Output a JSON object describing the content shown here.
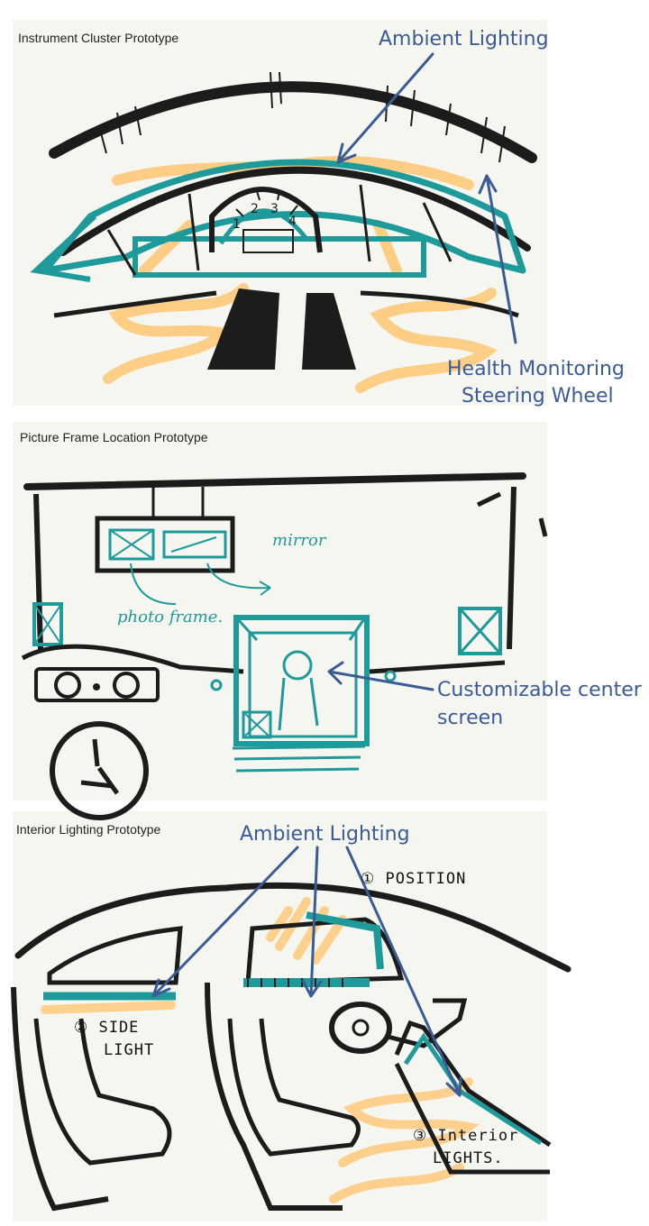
{
  "colors": {
    "paper": "#f6f6f1",
    "ink": "#1c1c1c",
    "teal": "#1e9a9a",
    "orange": "#ffc46b",
    "annotation_blue": "#3a5b94"
  },
  "panels": [
    {
      "title": "Instrument Cluster Prototype",
      "callouts": [
        "Ambient Lighting",
        "Health Monitoring",
        "Steering Wheel"
      ],
      "gauge_numbers": [
        "1",
        "2",
        "3",
        "4"
      ]
    },
    {
      "title": "Picture Frame Location Prototype",
      "sketch_labels": [
        "mirror",
        "photo frame."
      ],
      "callouts": [
        "Customizable center",
        "screen"
      ]
    },
    {
      "title": "Interior Lighting Prototype",
      "callouts": [
        "Ambient Lighting"
      ],
      "sketch_labels": [
        "① POSITION",
        "② SIDE",
        "LIGHT",
        "③ Interior",
        "LIGHTS."
      ]
    }
  ]
}
